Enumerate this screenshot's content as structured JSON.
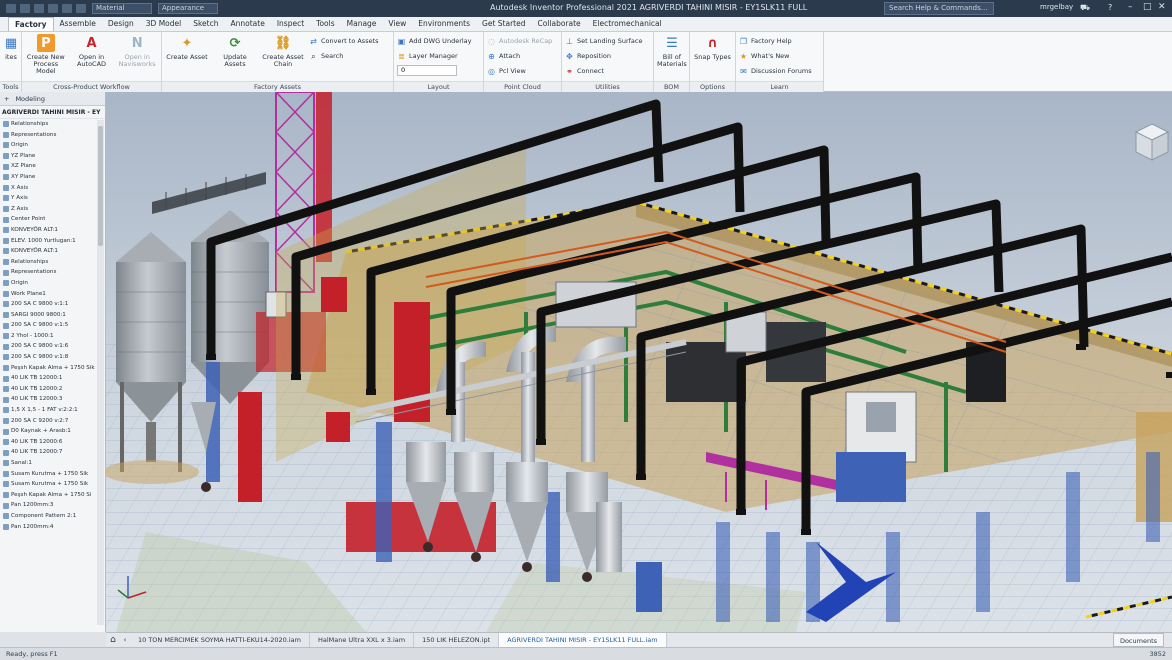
{
  "titlebar": {
    "material_combo": "Material",
    "appearance_combo": "Appearance",
    "app_title": "Autodesk Inventor Professional 2021    AGRIVERDI TAHINI MISIR - EY1SLK11 FULL",
    "search_placeholder": "Search Help & Commands...",
    "user": "mrgelbay",
    "cart_icon": "cart-icon",
    "help_icon": "help-icon",
    "minimize": "–",
    "maximize": "□",
    "close": "✕"
  },
  "ribbon_tabs": [
    "Factory",
    "Assemble",
    "Design",
    "3D Model",
    "Sketch",
    "Annotate",
    "Inspect",
    "Tools",
    "Manage",
    "View",
    "Environments",
    "Get Started",
    "Collaborate",
    "Electromechanical"
  ],
  "ribbon": {
    "tools": {
      "title": "Tools",
      "button": "ites"
    },
    "workflow": {
      "title": "Cross-Product Workflow",
      "create_process": "Create New Process Model",
      "open_autocad": "Open in AutoCAD",
      "open_navisworks": "Open in Navisworks"
    },
    "factory_assets": {
      "title": "Factory Assets",
      "create_asset": "Create Asset",
      "update_assets": "Update Assets",
      "create_chain": "Create Asset Chain",
      "convert": "Convert to Assets",
      "search": "Search"
    },
    "layout": {
      "title": "Layout",
      "add_dwg": "Add DWG Underlay",
      "layer_manager": "Layer Manager",
      "layer_value": "0"
    },
    "point_cloud": {
      "title": "Point Cloud",
      "autodesk_recap": "Autodesk ReCap",
      "attach": "Attach",
      "pcl_view": "Pcl View"
    },
    "utilities": {
      "title": "Utilities",
      "set_landing": "Set Landing Surface",
      "reposition": "Reposition",
      "connect": "Connect"
    },
    "bom": {
      "title": "BOM",
      "bill": "Bill of Materials"
    },
    "options": {
      "title": "Options",
      "snap": "Snap Types"
    },
    "learn": {
      "title": "Learn",
      "factory_help": "Factory Help",
      "whats_new": "What's New",
      "forums": "Discussion Forums"
    }
  },
  "browser": {
    "tab_plus": "+",
    "tab_model": "Modeling",
    "root": "AGRIVERDI TAHINI MISIR - EY",
    "items": [
      "Relationships",
      "Representations",
      "Origin",
      "YZ Plane",
      "XZ Plane",
      "XY Plane",
      "X Axis",
      "Y Axis",
      "Z Axis",
      "Center Point",
      "KONVEYÖR ALT:1",
      "ELEV. 1000 Yurtlugan:1",
      "KONVEYÖR ALT:1",
      "Relationships",
      "Representations",
      "Origin",
      "Work Plane1",
      "200 SA C 9800 v:1:1",
      "SARGI 9000 9800:1",
      "200 SA C 9800 v:1:5",
      "2 Yhol - 1000:1",
      "200 SA C 9800 v:1:6",
      "200 SA C 9800 v:1:8",
      "Peşsh Kapak Alma + 1750 Sik",
      "40 LIK TB 12000:1",
      "40 LIK TB 12000:2",
      "40 LIK TB 12000:3",
      "1,5 X 1,5 - 1 FAT v:2:2:1",
      "200 SA C 9200 v:2:7",
      "D0 Kaynak + Arasb:1",
      "40 LIK TB 12000:6",
      "40 LIK TB 12000:7",
      "Sanal:1",
      "Susam Kurutma + 1750 Sik",
      "Susam Kurutma + 1750 Sik",
      "Peşsh Kapak Alma + 1750 Si",
      "Pan 1200mm:3",
      "Component Pattern 2:1",
      "Pan 1200mm:4"
    ]
  },
  "doc_tabs": {
    "items": [
      "10 TON MERCIMEK SOYMA HATTI-EKU14-2020.iam",
      "HalMane Ultra XXL x 3.iam",
      "150 LIK HELEZON.ipt",
      "AGRIVERDI TAHINI MISIR - EY1SLK11 FULL.iam"
    ],
    "active_index": 3,
    "documents_label": "Documents"
  },
  "status": {
    "left": "Ready, press F1",
    "right": "3852"
  },
  "colors": {
    "title_bg": "#2b3a4d",
    "ribbon_bg": "#f7f8fa",
    "steel_frame": "#111111",
    "equipment_red": "#c4202a",
    "equipment_blue": "#3d62b6",
    "pipe_silver": "#c9ccd1",
    "tank_gray": "#9ca3a9",
    "hazard_yellow": "#f4d21a",
    "floor_tan": "#c7a25d",
    "frame_green": "#2f7d3b",
    "magenta_frame": "#b1309f"
  }
}
